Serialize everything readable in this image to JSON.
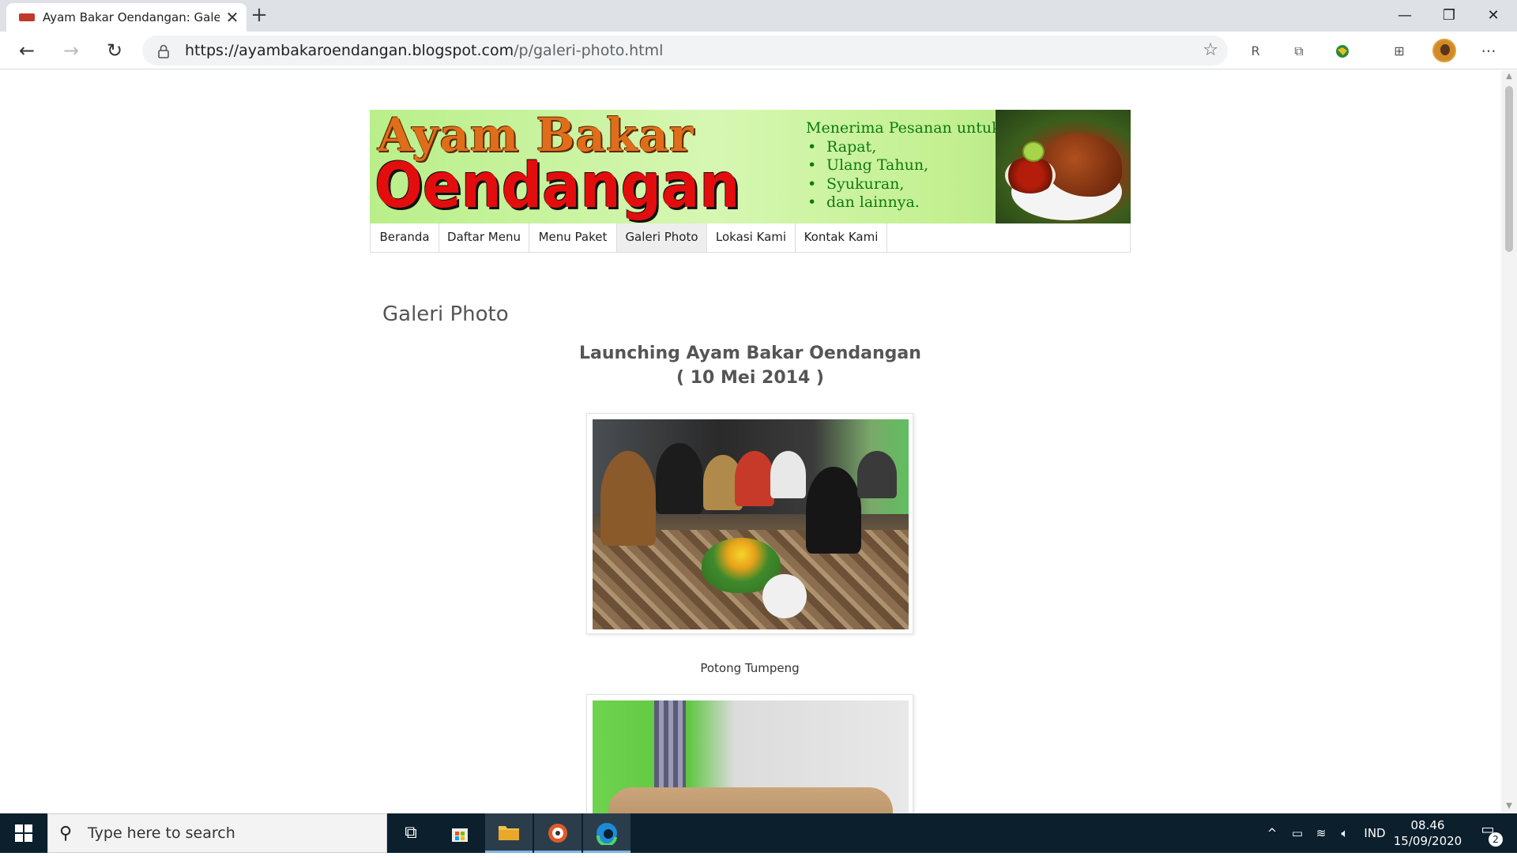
{
  "browser": {
    "tab_title": "Ayam Bakar Oendangan: Galeri P",
    "tab_close": "✕",
    "new_tab": "+",
    "url_domain": "https://ayambakaroendangan.blogspot.com",
    "url_path": "/p/galeri-photo.html",
    "window_minimize": "—",
    "window_restore": "❐",
    "window_close": "✕",
    "back": "←",
    "forward": "→",
    "refresh": "↻",
    "favorite": "☆",
    "more": "···"
  },
  "header": {
    "logo_line1": "Ayam Bakar",
    "logo_line2": "Oendangan",
    "offer_heading": "Menerima Pesanan untuk:",
    "offer_items": [
      "Rapat,",
      "Ulang Tahun,",
      "Syukuran,",
      "dan lainnya."
    ]
  },
  "nav": {
    "items": [
      {
        "label": "Beranda"
      },
      {
        "label": "Daftar Menu"
      },
      {
        "label": "Menu Paket"
      },
      {
        "label": "Galeri Photo"
      },
      {
        "label": "Lokasi Kami"
      },
      {
        "label": "Kontak Kami"
      }
    ],
    "active": "Galeri Photo"
  },
  "main": {
    "page_title": "Galeri Photo",
    "event_title": "Launching Ayam Bakar Oendangan",
    "event_date": "( 10 Mei 2014 )",
    "photos": [
      {
        "caption": "Potong Tumpeng"
      },
      {
        "caption": ""
      }
    ]
  },
  "taskbar": {
    "search_placeholder": "Type here to search",
    "language": "IND",
    "time": "08.46",
    "date": "15/09/2020",
    "notification_count": "2"
  }
}
